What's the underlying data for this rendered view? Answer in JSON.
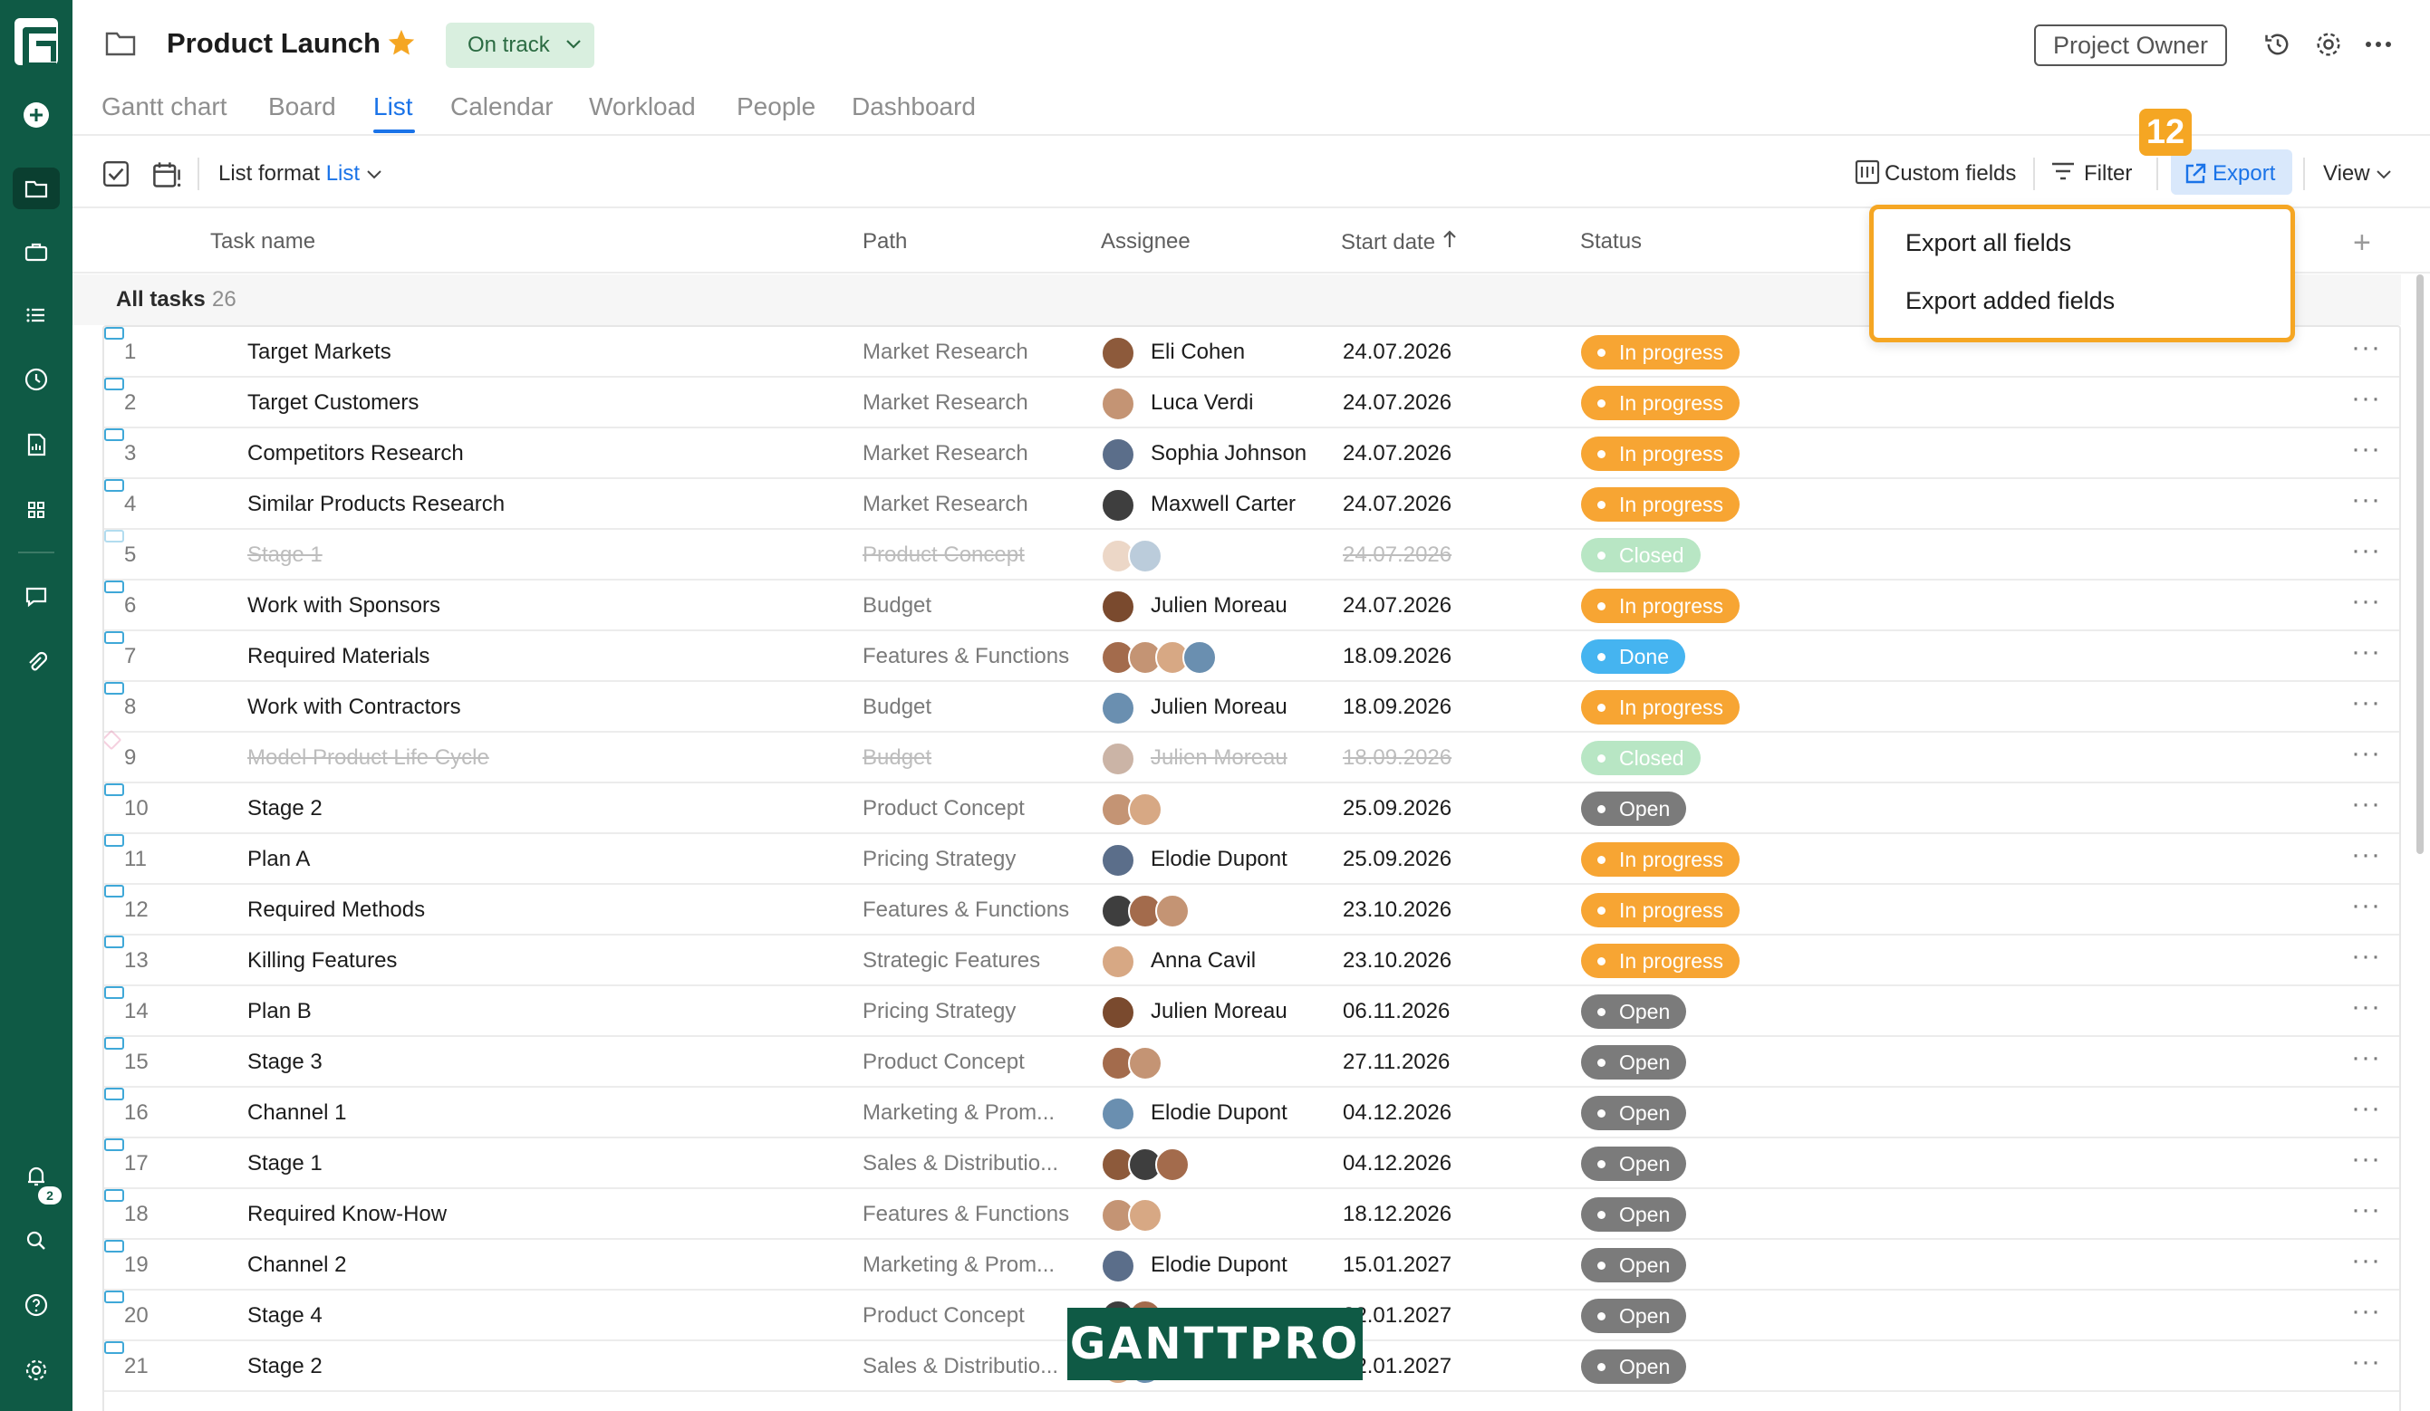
{
  "sidebar": {
    "logo": "G",
    "items": [
      "plus-circle-icon",
      "folder-icon",
      "briefcase-icon",
      "list-icon",
      "clock-icon",
      "report-icon",
      "grid-icon",
      "chat-icon",
      "paperclip-icon"
    ],
    "bottom_items": [
      "bell-icon",
      "search-icon",
      "help-icon",
      "settings-icon"
    ],
    "notification_count": "2",
    "accent_color": "#0f5a45"
  },
  "header": {
    "title": "Product Launch",
    "status": "On track",
    "role": "Project Owner"
  },
  "tabs": [
    {
      "label": "Gantt chart",
      "active": false
    },
    {
      "label": "Board",
      "active": false
    },
    {
      "label": "List",
      "active": true
    },
    {
      "label": "Calendar",
      "active": false
    },
    {
      "label": "Workload",
      "active": false
    },
    {
      "label": "People",
      "active": false
    },
    {
      "label": "Dashboard",
      "active": false
    }
  ],
  "toolbar": {
    "list_format_label": "List format",
    "list_format_value": "List",
    "custom_fields": "Custom fields",
    "filter": "Filter",
    "export": "Export",
    "view": "View",
    "step_number": "12"
  },
  "export_menu": {
    "items": [
      "Export all fields",
      "Export added fields"
    ]
  },
  "columns": {
    "task_name": "Task name",
    "path": "Path",
    "assignee": "Assignee",
    "start_date": "Start date",
    "status": "Status"
  },
  "group": {
    "label": "All tasks",
    "count": "26"
  },
  "rows": [
    {
      "num": "1",
      "name": "Target Markets",
      "path": "Market Research",
      "assignee": "Eli Cohen",
      "date": "24.07.2026",
      "status": "In progress",
      "avatars": 1
    },
    {
      "num": "2",
      "name": "Target Customers",
      "path": "Market Research",
      "assignee": "Luca Verdi",
      "date": "24.07.2026",
      "status": "In progress",
      "avatars": 1
    },
    {
      "num": "3",
      "name": "Competitors Research",
      "path": "Market Research",
      "assignee": "Sophia Johnson",
      "date": "24.07.2026",
      "status": "In progress",
      "avatars": 1
    },
    {
      "num": "4",
      "name": "Similar Products Research",
      "path": "Market Research",
      "assignee": "Maxwell Carter",
      "date": "24.07.2026",
      "status": "In progress",
      "avatars": 1
    },
    {
      "num": "5",
      "name": "Stage 1",
      "path": "Product Concept",
      "assignee": "",
      "date": "24.07.2026",
      "status": "Closed",
      "avatars": 2
    },
    {
      "num": "6",
      "name": "Work with Sponsors",
      "path": "Budget",
      "assignee": "Julien Moreau",
      "date": "24.07.2026",
      "status": "In progress",
      "avatars": 1
    },
    {
      "num": "7",
      "name": "Required Materials",
      "path": "Features & Functions",
      "assignee": "",
      "date": "18.09.2026",
      "status": "Done",
      "avatars": 4
    },
    {
      "num": "8",
      "name": "Work with Contractors",
      "path": "Budget",
      "assignee": "Julien Moreau",
      "date": "18.09.2026",
      "status": "In progress",
      "avatars": 1
    },
    {
      "num": "9",
      "name": "Model Product Life Cycle",
      "path": "Budget",
      "assignee": "Julien Moreau",
      "date": "18.09.2026",
      "status": "Closed",
      "avatars": 1
    },
    {
      "num": "10",
      "name": "Stage 2",
      "path": "Product Concept",
      "assignee": "",
      "date": "25.09.2026",
      "status": "Open",
      "avatars": 2
    },
    {
      "num": "11",
      "name": "Plan A",
      "path": "Pricing Strategy",
      "assignee": "Elodie Dupont",
      "date": "25.09.2026",
      "status": "In progress",
      "avatars": 1
    },
    {
      "num": "12",
      "name": "Required Methods",
      "path": "Features & Functions",
      "assignee": "",
      "date": "23.10.2026",
      "status": "In progress",
      "avatars": 3
    },
    {
      "num": "13",
      "name": "Killing Features",
      "path": "Strategic Features",
      "assignee": "Anna Cavil",
      "date": "23.10.2026",
      "status": "In progress",
      "avatars": 1
    },
    {
      "num": "14",
      "name": "Plan B",
      "path": "Pricing Strategy",
      "assignee": "Julien Moreau",
      "date": "06.11.2026",
      "status": "Open",
      "avatars": 1
    },
    {
      "num": "15",
      "name": "Stage 3",
      "path": "Product Concept",
      "assignee": "",
      "date": "27.11.2026",
      "status": "Open",
      "avatars": 2
    },
    {
      "num": "16",
      "name": "Channel 1",
      "path": "Marketing & Prom...",
      "assignee": "Elodie Dupont",
      "date": "04.12.2026",
      "status": "Open",
      "avatars": 1
    },
    {
      "num": "17",
      "name": "Stage 1",
      "path": "Sales & Distributio...",
      "assignee": "",
      "date": "04.12.2026",
      "status": "Open",
      "avatars": 3
    },
    {
      "num": "18",
      "name": "Required Know-How",
      "path": "Features & Functions",
      "assignee": "",
      "date": "18.12.2026",
      "status": "Open",
      "avatars": 2
    },
    {
      "num": "19",
      "name": "Channel 2",
      "path": "Marketing & Prom...",
      "assignee": "Elodie Dupont",
      "date": "15.01.2027",
      "status": "Open",
      "avatars": 1
    },
    {
      "num": "20",
      "name": "Stage 4",
      "path": "Product Concept",
      "assignee": "",
      "date": "22.01.2027",
      "status": "Open",
      "avatars": 2
    },
    {
      "num": "21",
      "name": "Stage 2",
      "path": "Sales & Distributio...",
      "assignee": "",
      "date": "22.01.2027",
      "status": "Open",
      "avatars": 2
    }
  ],
  "row_more": "···",
  "watermark": "GANTTPRO",
  "colors": {
    "in_progress": "#f7a533",
    "done": "#45b4f0",
    "open": "#7b7b7b",
    "closed": "#b8e6c4",
    "highlight": "#f5a623",
    "link": "#1a73e8"
  }
}
